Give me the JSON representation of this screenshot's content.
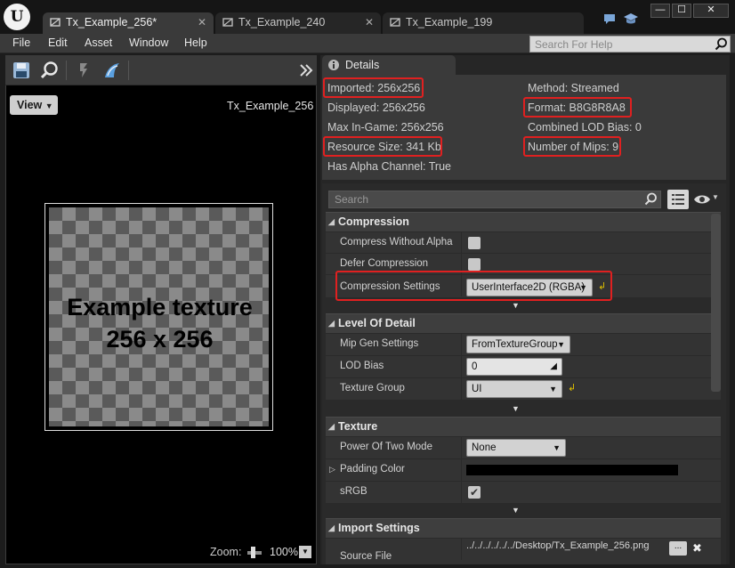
{
  "tabs": [
    {
      "label": "Tx_Example_256*",
      "active": true
    },
    {
      "label": "Tx_Example_240",
      "active": false
    },
    {
      "label": "Tx_Example_199",
      "active": false
    }
  ],
  "window_controls": {
    "minimize": "—",
    "maximize": "☐",
    "close": "✕"
  },
  "menu": [
    "File",
    "Edit",
    "Asset",
    "Window",
    "Help"
  ],
  "help_search": {
    "placeholder": "Search For Help"
  },
  "viewport": {
    "view_button": "View",
    "asset_name": "Tx_Example_256",
    "texture_text_line1": "Example texture",
    "texture_text_line2": "256 x 256",
    "zoom_label": "Zoom:",
    "zoom_value": "100%"
  },
  "details": {
    "tab_label": "Details",
    "info_left": [
      "Imported: 256x256",
      "Displayed: 256x256",
      "Max In-Game: 256x256",
      "Resource Size: 341 Kb",
      "Has Alpha Channel: True"
    ],
    "info_right": [
      "Method: Streamed",
      "Format: B8G8R8A8",
      "Combined LOD Bias: 0",
      "Number of Mips: 9"
    ],
    "search_placeholder": "Search",
    "categories": {
      "compression": {
        "title": "Compression",
        "compress_without_alpha": "Compress Without Alpha",
        "defer_compression": "Defer Compression",
        "compression_settings": "Compression Settings",
        "compression_settings_value": "UserInterface2D (RGBA)"
      },
      "lod": {
        "title": "Level Of Detail",
        "mip_gen_settings": "Mip Gen Settings",
        "mip_gen_value": "FromTextureGroup",
        "lod_bias": "LOD Bias",
        "lod_bias_value": "0",
        "texture_group": "Texture Group",
        "texture_group_value": "UI"
      },
      "texture": {
        "title": "Texture",
        "power_of_two": "Power Of Two Mode",
        "power_of_two_value": "None",
        "padding_color": "Padding Color",
        "srgb": "sRGB"
      },
      "import": {
        "title": "Import Settings",
        "source_file": "Source File",
        "source_file_value": "../../../../../../Desktop/Tx_Example_256.png",
        "browse": "...",
        "clear": "✖"
      }
    }
  },
  "colors": {
    "highlight": "#e02020",
    "reset_arrow": "#e0c000"
  }
}
